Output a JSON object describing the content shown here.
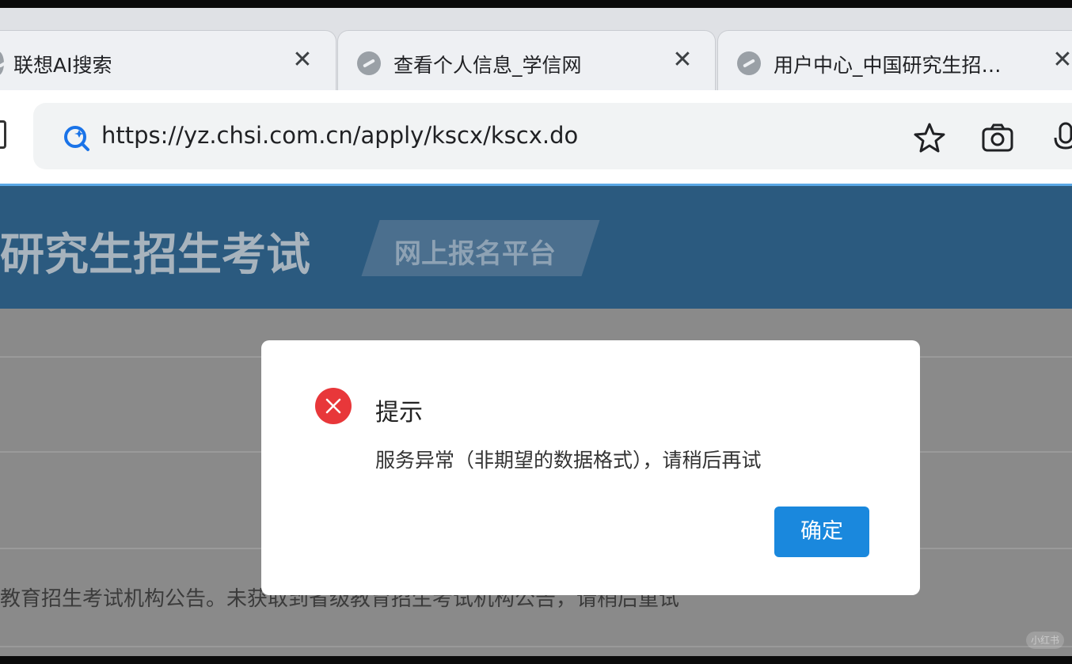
{
  "browser": {
    "tabs": [
      {
        "title": "联想AI搜索",
        "close": "✕"
      },
      {
        "title": "查看个人信息_学信网",
        "close": "✕"
      },
      {
        "title": "用户中心_中国研究生招…",
        "close": "✕"
      }
    ],
    "url": "https://yz.chsi.com.cn/apply/kscx/kscx.do",
    "icons": [
      "lenovo-ai-search-icon",
      "star-icon",
      "camera-icon",
      "microphone-icon"
    ],
    "accent_color": "#5aa8e6"
  },
  "page": {
    "site_title": "研究生招生考试",
    "badge": "网上报名平台",
    "notice": "教育招生考试机构公告。未获取到省级教育招生考试机构公告，请稍后重试",
    "header_color": "#2b5a7f"
  },
  "dialog": {
    "title": "提示",
    "message": "服务异常（非期望的数据格式），请稍后再试",
    "confirm_label": "确定",
    "error_color": "#e8373a",
    "button_color": "#1a88dd"
  },
  "watermark": "小红书"
}
